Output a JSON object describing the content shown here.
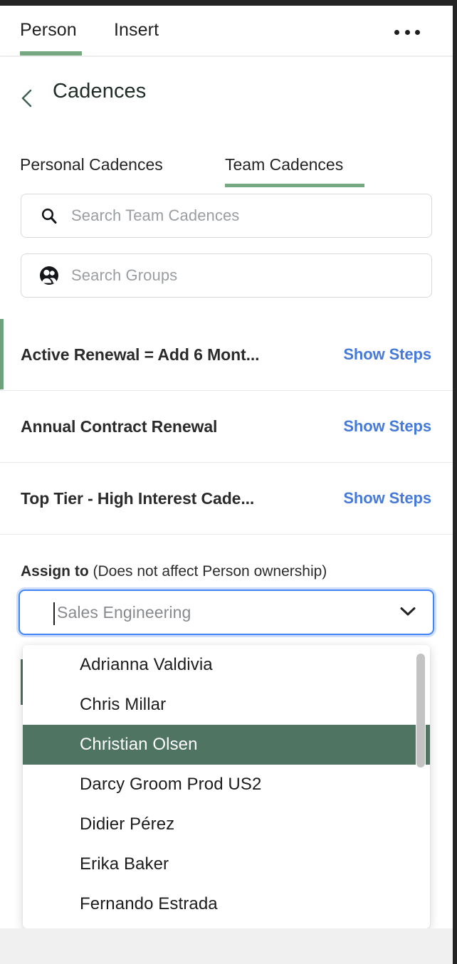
{
  "window": {
    "frame_color": "#242424"
  },
  "top_tabs": {
    "items": [
      {
        "label": "Person",
        "active": true
      },
      {
        "label": "Insert",
        "active": false
      }
    ],
    "overflow_icon": "ellipsis-icon",
    "accent_color": "#76a881"
  },
  "header": {
    "back_icon": "chevron-left-icon",
    "title": "Cadences"
  },
  "subtabs": {
    "items": [
      {
        "label": "Personal Cadences",
        "active": false
      },
      {
        "label": "Team Cadences",
        "active": true
      }
    ],
    "accent_color": "#76a881"
  },
  "search": {
    "cadences": {
      "icon": "search-icon",
      "placeholder": "Search Team Cadences",
      "value": ""
    },
    "groups": {
      "icon": "group-icon",
      "placeholder": "Search Groups",
      "value": ""
    }
  },
  "cadences": {
    "action_label": "Show Steps",
    "action_color": "#4579da",
    "selected_accent": "#6fa17c",
    "rows": [
      {
        "name": "Active Renewal = Add 6 Mont...",
        "action": "Show Steps",
        "selected": true
      },
      {
        "name": "Annual Contract Renewal",
        "action": "Show Steps",
        "selected": false
      },
      {
        "name": "Top Tier - High Interest Cade...",
        "action": "Show Steps",
        "selected": false
      }
    ]
  },
  "assign": {
    "label_bold": "Assign to",
    "label_note": " (Does not affect Person ownership)",
    "select": {
      "placeholder": "Sales Engineering",
      "value": "",
      "focused": true,
      "focus_color": "#4285f4",
      "chevron_icon": "chevron-down-icon"
    },
    "dropdown": {
      "highlight_color": "#4f7461",
      "options": [
        {
          "label": "Adrianna Valdivia",
          "highlighted": false
        },
        {
          "label": "Chris Millar",
          "highlighted": false
        },
        {
          "label": "Christian Olsen",
          "highlighted": true
        },
        {
          "label": "Darcy Groom Prod US2",
          "highlighted": false
        },
        {
          "label": "Didier Pérez",
          "highlighted": false
        },
        {
          "label": "Erika Baker",
          "highlighted": false
        },
        {
          "label": "Fernando Estrada",
          "highlighted": false
        }
      ]
    }
  }
}
